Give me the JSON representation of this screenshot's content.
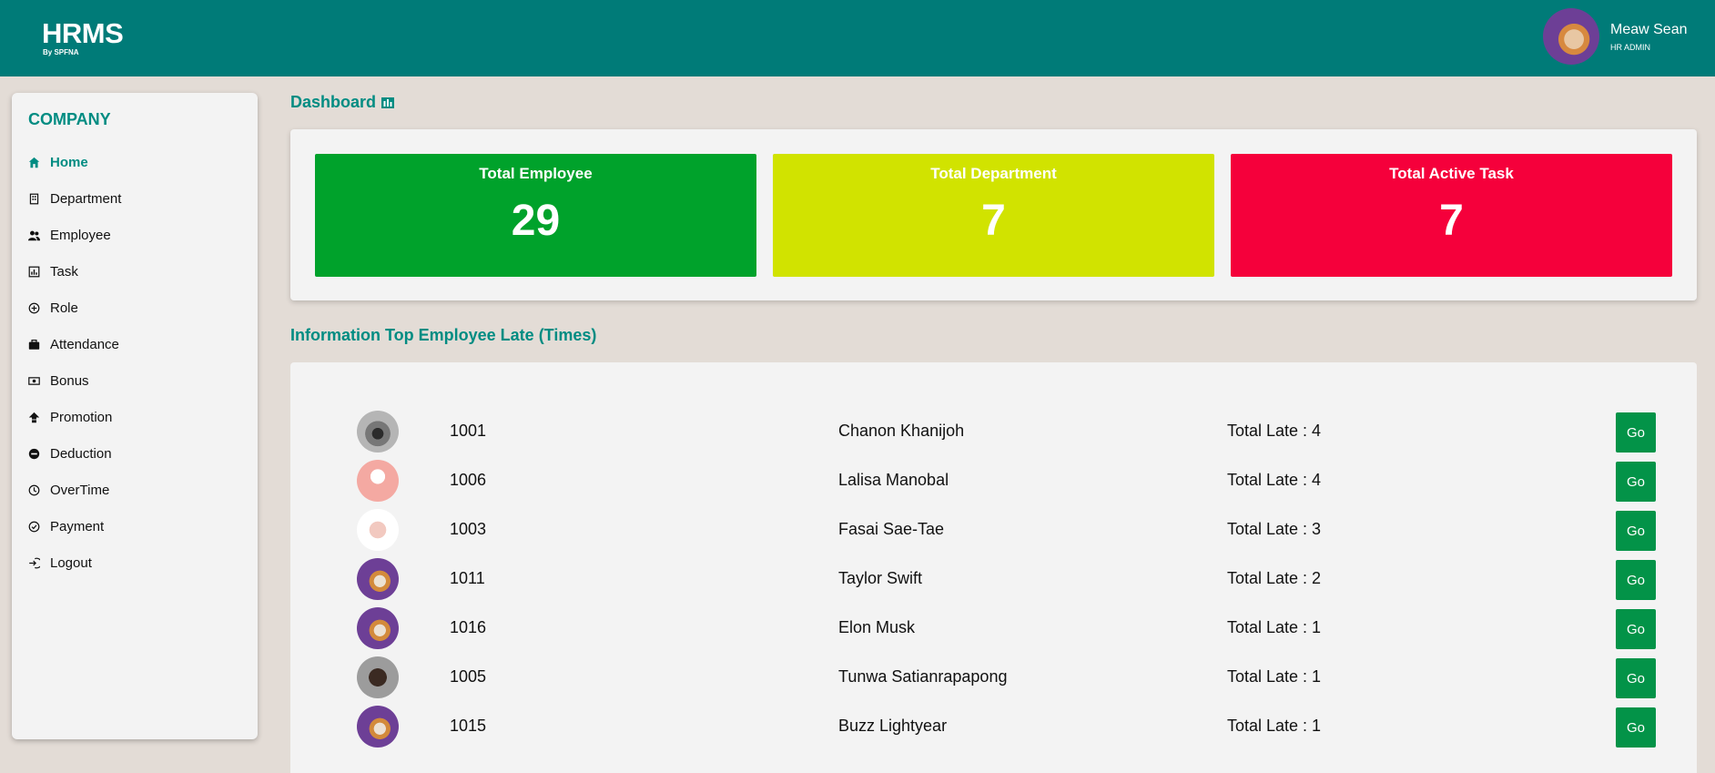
{
  "header": {
    "logo_main": "HRMS",
    "logo_sub": "By SPFNA",
    "user_name": "Meaw Sean",
    "user_role": "HR ADMIN"
  },
  "sidebar": {
    "company_label": "COMPANY",
    "items": [
      {
        "label": "Home",
        "icon": "home-icon",
        "active": true
      },
      {
        "label": "Department",
        "icon": "building-icon"
      },
      {
        "label": "Employee",
        "icon": "users-icon"
      },
      {
        "label": "Task",
        "icon": "chart-icon"
      },
      {
        "label": "Role",
        "icon": "plus-circle-icon"
      },
      {
        "label": "Attendance",
        "icon": "briefcase-icon"
      },
      {
        "label": "Bonus",
        "icon": "money-icon"
      },
      {
        "label": "Promotion",
        "icon": "promotion-icon"
      },
      {
        "label": "Deduction",
        "icon": "minus-circle-icon"
      },
      {
        "label": "OverTime",
        "icon": "clock-icon"
      },
      {
        "label": "Payment",
        "icon": "check-circle-icon"
      },
      {
        "label": "Logout",
        "icon": "logout-icon"
      }
    ]
  },
  "main": {
    "dashboard_title": "Dashboard",
    "stats": [
      {
        "label": "Total Employee",
        "value": "29",
        "color": "#00a22b"
      },
      {
        "label": "Total Department",
        "value": "7",
        "color": "#d1e300"
      },
      {
        "label": "Total Active Task",
        "value": "7",
        "color": "#f5003b"
      }
    ],
    "late_section_title": "Information Top Employee Late (Times)",
    "late_employees": [
      {
        "id": "1001",
        "name": "Chanon Khanijoh",
        "late": "Total Late : 4",
        "go": "Go"
      },
      {
        "id": "1006",
        "name": "Lalisa Manobal",
        "late": "Total Late : 4",
        "go": "Go"
      },
      {
        "id": "1003",
        "name": "Fasai Sae-Tae",
        "late": "Total Late : 3",
        "go": "Go"
      },
      {
        "id": "1011",
        "name": "Taylor Swift",
        "late": "Total Late : 2",
        "go": "Go"
      },
      {
        "id": "1016",
        "name": "Elon Musk",
        "late": "Total Late : 1",
        "go": "Go"
      },
      {
        "id": "1005",
        "name": "Tunwa Satianrapapong",
        "late": "Total Late : 1",
        "go": "Go"
      },
      {
        "id": "1015",
        "name": "Buzz Lightyear",
        "late": "Total Late : 1",
        "go": "Go"
      }
    ]
  },
  "colors": {
    "topbar": "#007b78",
    "accent": "#008c82",
    "background": "#e3dcd6",
    "go_button": "#039348"
  }
}
